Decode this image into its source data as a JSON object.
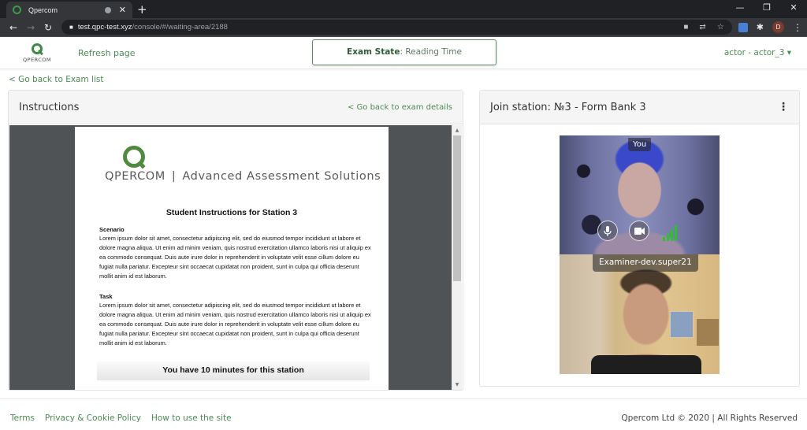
{
  "browser": {
    "tab_title": "Qpercom",
    "url_host": "test.qpc-test.xyz",
    "url_path": "/console/#/waiting-area/2188",
    "profile_initial": "D",
    "icons": {
      "back": "←",
      "forward": "→",
      "reload": "↻",
      "lock": "🔒",
      "camera": "■",
      "translate": "⇄",
      "star": "☆",
      "extensions": "✱",
      "menu": "⋮",
      "minimize": "—",
      "maximize": "❐",
      "close": "✕",
      "new_tab": "+",
      "tab_close": "✕"
    }
  },
  "header": {
    "logo_text": "QPERCOM",
    "refresh_label": "Refresh page",
    "exam_state_label": "Exam State",
    "exam_state_value": ": Reading Time",
    "user_menu_label": "actor - actor_3 ▾"
  },
  "back_to_list": "< Go back to Exam list",
  "instructions": {
    "title": "Instructions",
    "back_link": "< Go back to exam details",
    "document": {
      "brand_name": "QPERCOM",
      "brand_sep": "|",
      "brand_tagline": "Advanced Assessment Solutions",
      "title": "Student Instructions for Station 3",
      "sections": [
        {
          "heading": "Scenario",
          "body": "Lorem ipsum dolor sit amet, consectetur adipiscing elit, sed do eiusmod tempor incididunt ut labore et dolore magna aliqua. Ut enim ad minim veniam, quis nostrud exercitation ullamco laboris nisi ut aliquip ex ea commodo consequat. Duis aute irure dolor in reprehenderit in voluptate velit esse cillum dolore eu fugiat nulla pariatur. Excepteur sint occaecat cupidatat non proident, sunt in culpa qui officia deserunt mollit anim id est laborum."
        },
        {
          "heading": "Task",
          "body": "Lorem ipsum dolor sit amet, consectetur adipiscing elit, sed do eiusmod tempor incididunt ut labore et dolore magna aliqua. Ut enim ad minim veniam, quis nostrud exercitation ullamco laboris nisi ut aliquip ex ea commodo consequat. Duis aute irure dolor in reprehenderit in voluptate velit esse cillum dolore eu fugiat nulla pariatur. Excepteur sint occaecat cupidatat non proident, sunt in culpa qui officia deserunt mollit anim id est laborum."
        }
      ],
      "time_notice": "You have 10 minutes for this station"
    },
    "scroll": {
      "up": "▲",
      "down": "▼"
    }
  },
  "station": {
    "title": "Join station: №3 - Form Bank 3",
    "menu_icon": "⋮",
    "self_label": "You",
    "examiner_label": "Examiner-dev.super21",
    "mic_icon": "🎙",
    "camera_icon": "■",
    "signal_bars": 4
  },
  "footer": {
    "links": [
      "Terms",
      "Privacy & Cookie Policy",
      "How to use the site"
    ],
    "copyright": "Qpercom Ltd © 2020 | All Rights Reserved"
  }
}
